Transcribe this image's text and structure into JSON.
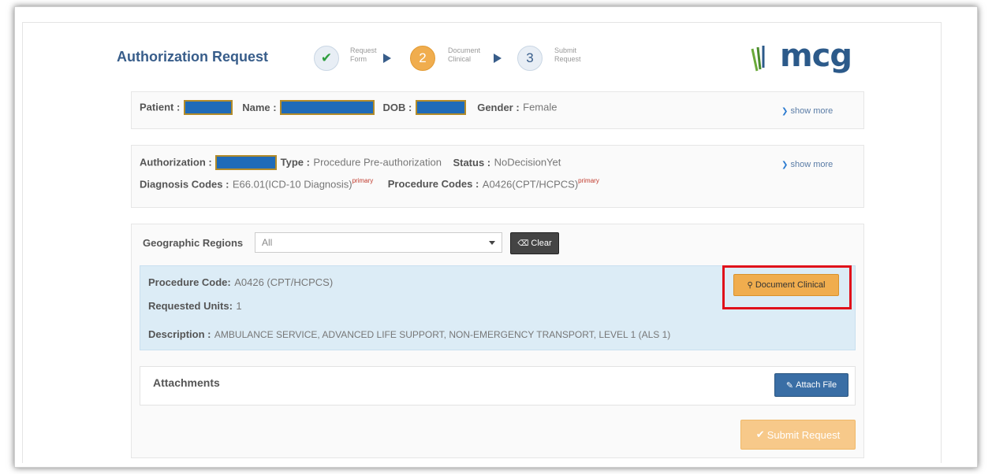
{
  "header": {
    "title": "Authorization Request",
    "steps": [
      {
        "number": "✔",
        "label_line1": "Request",
        "label_line2": "Form",
        "state": "done"
      },
      {
        "number": "2",
        "label_line1": "Document",
        "label_line2": "Clinical",
        "state": "active"
      },
      {
        "number": "3",
        "label_line1": "Submit",
        "label_line2": "Request",
        "state": "pending"
      }
    ],
    "logo_text": "mcg"
  },
  "patient": {
    "patient_label": "Patient :",
    "name_label": "Name :",
    "dob_label": "DOB :",
    "gender_label": "Gender :",
    "gender_value": "Female",
    "show_more": "show more"
  },
  "authorization": {
    "auth_label": "Authorization :",
    "type_label": "Type :",
    "type_value": "Procedure Pre-authorization",
    "status_label": "Status :",
    "status_value": "NoDecisionYet",
    "diag_label": "Diagnosis Codes :",
    "diag_value": "E66.01(ICD-10 Diagnosis)",
    "diag_tag": "primary",
    "proc_label": "Procedure Codes :",
    "proc_value": "A0426(CPT/HCPCS)",
    "proc_tag": "primary",
    "show_more": "show more"
  },
  "regions": {
    "label": "Geographic Regions",
    "selected": "All",
    "clear_label": "Clear"
  },
  "procedure": {
    "code_label": "Procedure Code:",
    "code_value": "A0426 (CPT/HCPCS)",
    "units_label": "Requested Units:",
    "units_value": "1",
    "desc_label": "Description :",
    "desc_value": "AMBULANCE SERVICE, ADVANCED LIFE SUPPORT, NON-EMERGENCY TRANSPORT, LEVEL 1 (ALS 1)",
    "document_clinical_label": "Document Clinical"
  },
  "attachments": {
    "title": "Attachments",
    "attach_label": "Attach File"
  },
  "footer": {
    "submit_label": "Submit Request"
  },
  "colors": {
    "accent": "#385d8a",
    "step_done": "#2e9e3e",
    "step_active": "#f0ad4e",
    "highlight": "#e0101a"
  }
}
